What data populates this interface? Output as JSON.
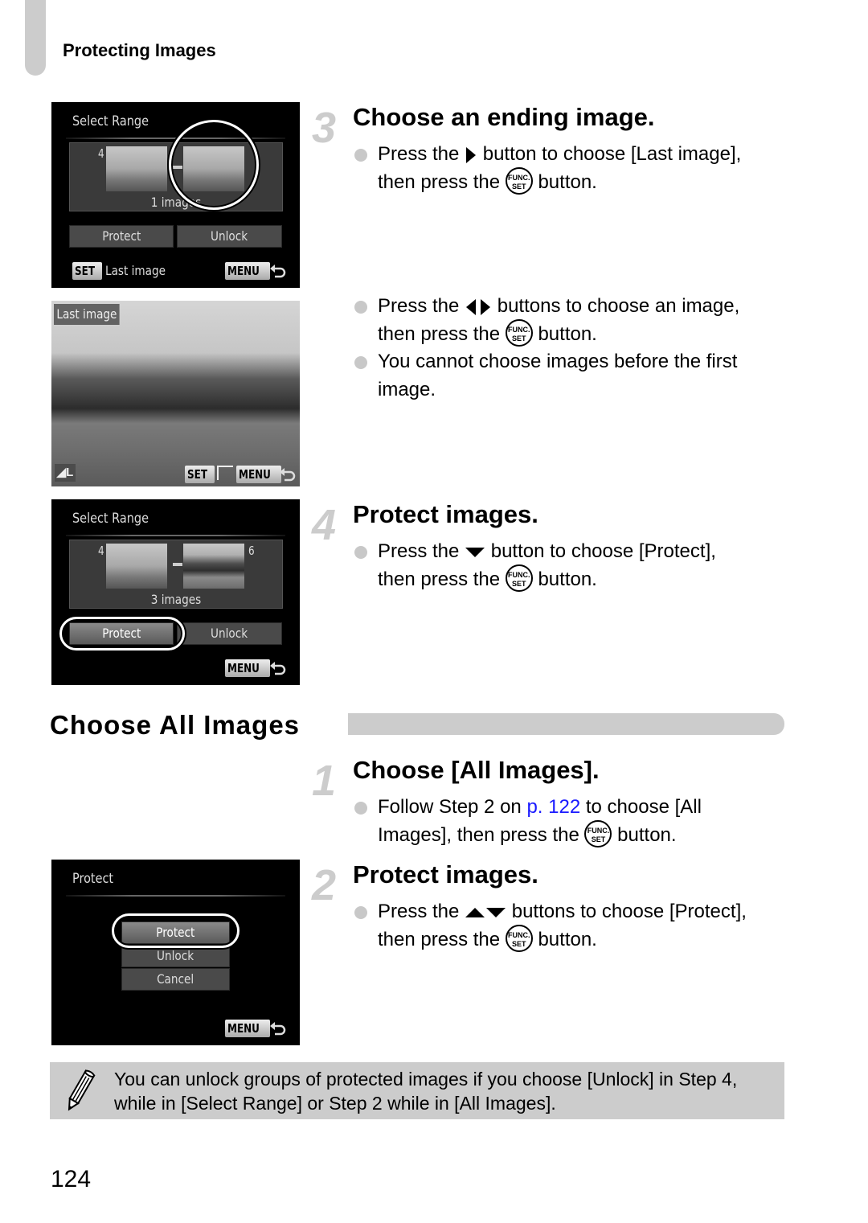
{
  "running_head": "Protecting Images",
  "page_number": "124",
  "screens": {
    "select_range_last": {
      "title": "Select Range",
      "first_num": "4",
      "count": "1 images",
      "buttons": [
        "Protect",
        "Unlock"
      ],
      "footer_key": "SET",
      "footer_text": "Last image",
      "menu_key": "MENU"
    },
    "last_image_view": {
      "label": "Last image",
      "footer_keys": [
        "SET",
        "MENU"
      ]
    },
    "select_range_protect": {
      "title": "Select Range",
      "first_num": "4",
      "last_num": "6",
      "count": "3 images",
      "buttons": [
        "Protect",
        "Unlock"
      ],
      "menu_key": "MENU"
    },
    "protect_all": {
      "title": "Protect",
      "options": [
        "Protect",
        "Unlock",
        "Cancel"
      ],
      "menu_key": "MENU"
    }
  },
  "steps": [
    {
      "number": "3",
      "title": "Choose an ending image.",
      "bullets": [
        {
          "pre": "Press the",
          "icon": "right-arrow",
          "mid": "button to choose [Last image],",
          "line2_pre": "then press the",
          "func": "FUNC. SET",
          "post": "button."
        },
        {
          "pre": "Press the",
          "icon": "left-right-arrows",
          "mid": "buttons to choose an image,",
          "line2_pre": "then press the",
          "func": "FUNC. SET",
          "post": "button."
        },
        {
          "text": "You cannot choose images before the first image."
        }
      ]
    },
    {
      "number": "4",
      "title": "Protect images.",
      "bullets": [
        {
          "pre": "Press the",
          "icon": "down-arrow",
          "mid": "button to choose [Protect],",
          "line2_pre": "then press the",
          "func": "FUNC. SET",
          "post": "button."
        }
      ]
    }
  ],
  "section": {
    "title": "Choose All Images",
    "steps": [
      {
        "number": "1",
        "title": "Choose [All Images].",
        "bullet": {
          "pre": "Follow Step 2 on",
          "link": "p. 122",
          "mid": "to choose [All",
          "line2_pre": "Images], then press the",
          "func": "FUNC. SET",
          "post": "button."
        }
      },
      {
        "number": "2",
        "title": "Protect images.",
        "bullet": {
          "pre": "Press the",
          "icon": "up-down-arrows",
          "mid": "buttons to choose [Protect],",
          "line2_pre": "then press the",
          "func": "FUNC. SET",
          "post": "button."
        }
      }
    ]
  },
  "note": {
    "icon": "pencil-icon",
    "text": "You can unlock groups of protected images if you choose [Unlock] in Step 4, while in [Select Range] or Step 2 while in [All Images]."
  },
  "func_label_top": "FUNC.",
  "func_label_bottom": "SET"
}
